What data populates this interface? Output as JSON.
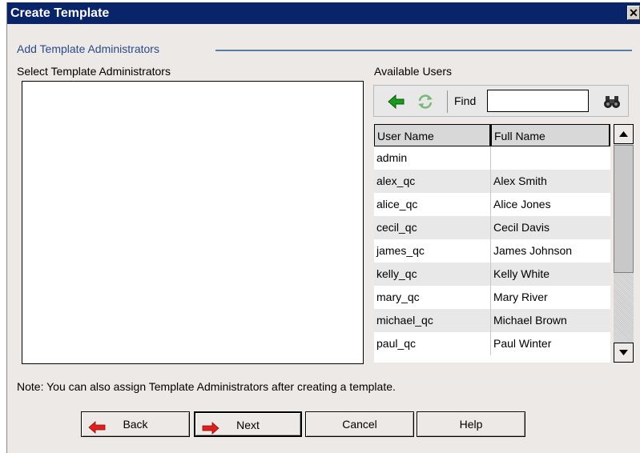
{
  "window": {
    "title": "Create Template",
    "close_glyph": "✕"
  },
  "section": {
    "legend": "Add Template Administrators",
    "left_label": "Select Template Administrators",
    "right_label": "Available Users"
  },
  "toolbar": {
    "add_icon": "green-left-arrow-icon",
    "refresh_icon": "refresh-icon",
    "find_label": "Find",
    "find_value": "",
    "find_icon": "binoculars-icon"
  },
  "users_table": {
    "headers": [
      "User Name",
      "Full Name"
    ],
    "rows": [
      [
        "admin",
        ""
      ],
      [
        "alex_qc",
        "Alex Smith"
      ],
      [
        "alice_qc",
        "Alice Jones"
      ],
      [
        "cecil_qc",
        "Cecil Davis"
      ],
      [
        "james_qc",
        "James Johnson"
      ],
      [
        "kelly_qc",
        "Kelly White"
      ],
      [
        "mary_qc",
        "Mary River"
      ],
      [
        "michael_qc",
        "Michael Brown"
      ],
      [
        "paul_qc",
        "Paul Winter"
      ]
    ]
  },
  "note": "Note: You can also assign Template Administrators after creating a template.",
  "buttons": {
    "back": "Back",
    "next": "Next",
    "cancel": "Cancel",
    "help": "Help"
  },
  "colors": {
    "titlebar": "#0a246a",
    "legend": "#2a4a8a",
    "arrow_red": "#e0201c",
    "arrow_green": "#1a9a1a"
  }
}
